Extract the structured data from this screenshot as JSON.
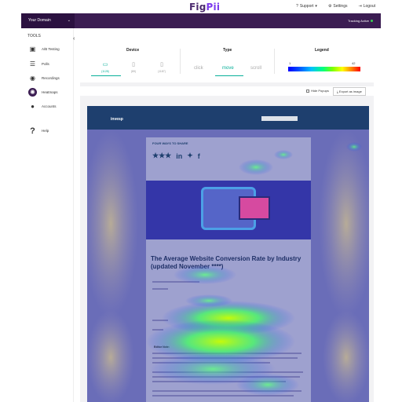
{
  "header": {
    "logo_main": "Fig",
    "logo_accent": "Pii",
    "support_label": "Support",
    "settings_label": "Settings",
    "logout_label": "Logout"
  },
  "domainbar": {
    "domain_label": "Your Domain",
    "tracking_label": "Tracking Active"
  },
  "sidebar": {
    "title": "TOOLS",
    "items": [
      {
        "label": "A/B Testing",
        "icon": "ab-testing-icon"
      },
      {
        "label": "Polls",
        "icon": "polls-icon"
      },
      {
        "label": "Recordings",
        "icon": "recordings-icon"
      },
      {
        "label": "Heatmaps",
        "icon": "heatmaps-icon",
        "active": true
      },
      {
        "label": "Accounts",
        "icon": "accounts-icon"
      },
      {
        "label": "Help",
        "icon": "help-icon"
      }
    ]
  },
  "filters": {
    "device_title": "Device",
    "devices": [
      {
        "label": "(1128)",
        "icon": "desktop-icon",
        "active": true
      },
      {
        "label": "(89)",
        "icon": "tablet-icon"
      },
      {
        "label": "(1187)",
        "icon": "mobile-icon"
      }
    ],
    "type_title": "Type",
    "types": [
      {
        "label": "click"
      },
      {
        "label": "move",
        "active": true
      },
      {
        "label": "scroll"
      }
    ],
    "legend_title": "Legend",
    "legend_min": "1",
    "legend_max": "42"
  },
  "actions": {
    "hide_popups_label": "Hide Popups",
    "export_label": "Export as image"
  },
  "preview": {
    "site_logo": "invesp",
    "section_title": "FOUR WAYS TO SHARE",
    "share_count": "★★★",
    "article_title": "The Average Website Conversion Rate by Industry (updated November ****)",
    "editor_note": "Editor Note:"
  },
  "colors": {
    "brand_purple": "#3b1d52",
    "accent_teal": "#0ab09a",
    "tracking_dot": "#39d353"
  }
}
